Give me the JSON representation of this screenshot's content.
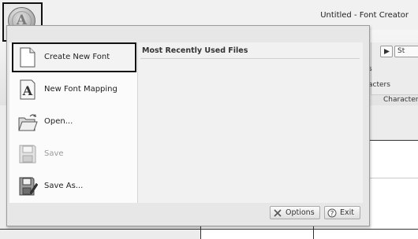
{
  "window": {
    "title": "Untitled - Font Creator"
  },
  "ribbon": {
    "fragments": [
      "s",
      "acters"
    ],
    "group_label": "Character",
    "button_text": "St"
  },
  "app_button": {
    "letter": "A"
  },
  "menu": {
    "items": [
      {
        "label": "Create New Font",
        "icon": "new-document-icon",
        "selected": true,
        "enabled": true
      },
      {
        "label": "New Font Mapping",
        "icon": "font-mapping-icon",
        "selected": false,
        "enabled": true
      },
      {
        "label": "Open...",
        "icon": "open-folder-icon",
        "selected": false,
        "enabled": true
      },
      {
        "label": "Save",
        "icon": "save-icon",
        "selected": false,
        "enabled": false
      },
      {
        "label": "Save As...",
        "icon": "save-as-icon",
        "selected": false,
        "enabled": true
      }
    ],
    "recent_files_title": "Most Recently Used Files",
    "options_label": "Options",
    "exit_label": "Exit"
  },
  "colors": {
    "selection_border": "#111111",
    "menu_bg": "#e7e7e7",
    "disabled_text": "#9a9a9a"
  }
}
